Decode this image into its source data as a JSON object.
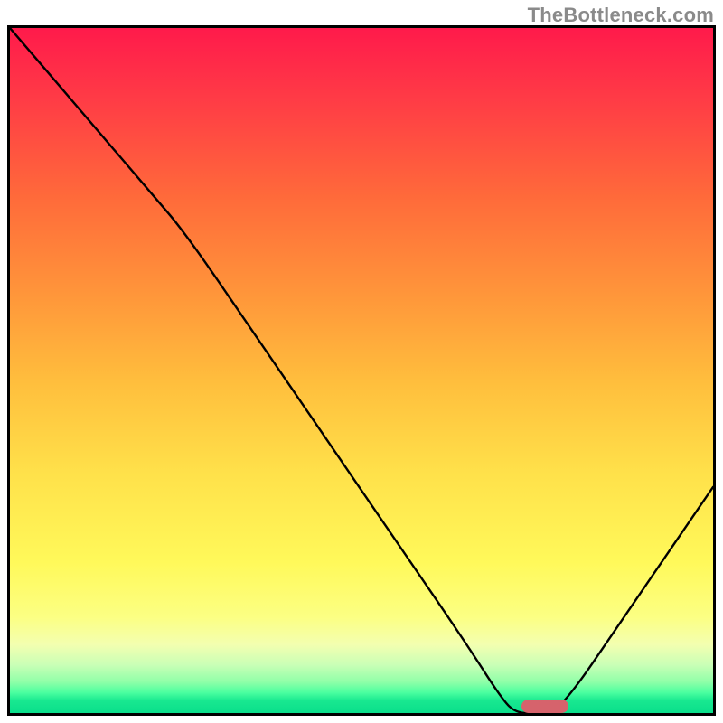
{
  "watermark": "TheBottleneck.com",
  "chart_data": {
    "type": "line",
    "title": "",
    "xlabel": "",
    "ylabel": "",
    "xlim": [
      0,
      100
    ],
    "ylim": [
      0,
      100
    ],
    "grid": false,
    "legend": false,
    "x": [
      0,
      10,
      20,
      25,
      35,
      45,
      55,
      65,
      70,
      72,
      75,
      78,
      88,
      100
    ],
    "values": [
      100,
      88,
      76,
      70,
      55,
      40,
      25,
      10,
      2,
      0,
      0,
      0,
      15,
      33
    ],
    "optimum_marker": {
      "x_center": 75.5,
      "y": 0,
      "width_pct": 6.6
    },
    "colors": {
      "gradient_top": "#ff1a4b",
      "gradient_mid": "#ffe14a",
      "gradient_bottom": "#0adf8b",
      "curve": "#000000",
      "marker": "#d6636c",
      "border": "#000000"
    }
  }
}
